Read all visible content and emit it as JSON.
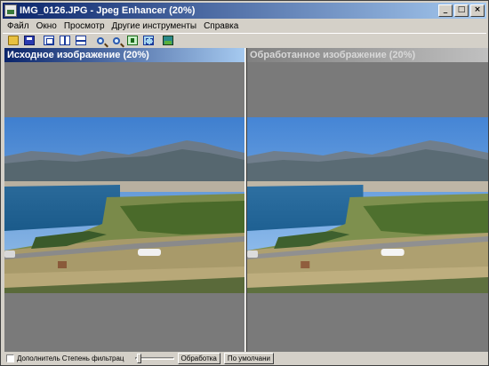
{
  "window": {
    "title": "IMG_0126.JPG - Jpeg Enhancer (20%)",
    "buttons": {
      "minimize": "_",
      "maximize": "□",
      "close": "×"
    }
  },
  "menu": {
    "items": [
      {
        "label": "Файл"
      },
      {
        "label": "Окно"
      },
      {
        "label": "Просмотр"
      },
      {
        "label": "Другие инструменты"
      },
      {
        "label": "Справка"
      }
    ]
  },
  "toolbar": {
    "icons": [
      "open-folder-icon",
      "save-icon",
      "copy-icon",
      "vertical-split-icon",
      "horizontal-split-icon",
      "zoom-in-icon",
      "zoom-out-icon",
      "fit-to-window-icon",
      "frame-icon",
      "image-icon"
    ]
  },
  "panels": {
    "left": {
      "title": "Исходное изображение (20%)"
    },
    "right": {
      "title": "Обработанное изображение (20%)"
    }
  },
  "statusbar": {
    "checkbox_label": "Дополнитель",
    "filter_label": "Степень фильтрац",
    "process_button": "Обработка",
    "default_button": "По умолчани",
    "filter_level": 0.05
  }
}
